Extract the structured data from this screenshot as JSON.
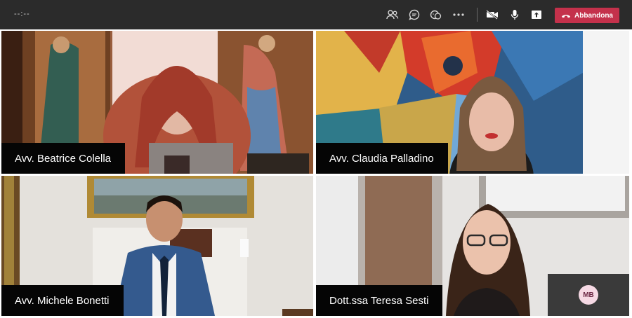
{
  "toolbar": {
    "timer": "--:--",
    "icons": [
      "participants-icon",
      "chat-icon",
      "reactions-icon",
      "more-icon",
      "camera-off-icon",
      "microphone-icon",
      "share-screen-icon"
    ],
    "leave_label": "Abbandona",
    "leave_color": "#c4314b"
  },
  "participants": [
    {
      "name": "Avv. Beatrice Colella"
    },
    {
      "name": "Avv. Claudia Palladino"
    },
    {
      "name": "Avv. Michele Bonetti"
    },
    {
      "name": "Dott.ssa Teresa Sesti"
    }
  ],
  "self_avatar": {
    "initials": "MB"
  }
}
